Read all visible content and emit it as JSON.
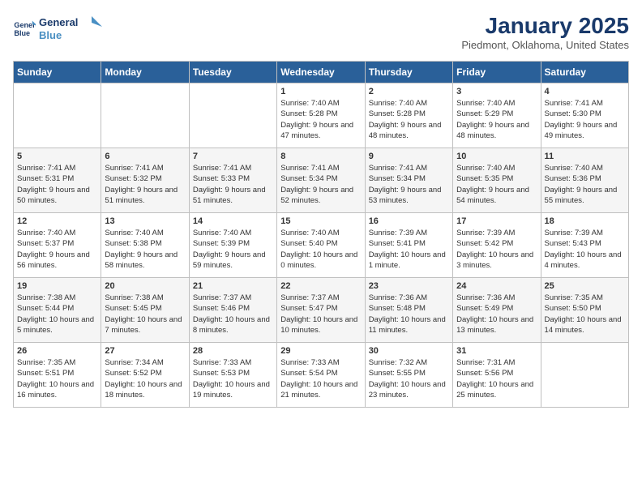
{
  "header": {
    "logo_line1": "General",
    "logo_line2": "Blue",
    "month": "January 2025",
    "location": "Piedmont, Oklahoma, United States"
  },
  "days_of_week": [
    "Sunday",
    "Monday",
    "Tuesday",
    "Wednesday",
    "Thursday",
    "Friday",
    "Saturday"
  ],
  "weeks": [
    [
      {
        "day": "",
        "info": ""
      },
      {
        "day": "",
        "info": ""
      },
      {
        "day": "",
        "info": ""
      },
      {
        "day": "1",
        "info": "Sunrise: 7:40 AM\nSunset: 5:28 PM\nDaylight: 9 hours and 47 minutes."
      },
      {
        "day": "2",
        "info": "Sunrise: 7:40 AM\nSunset: 5:28 PM\nDaylight: 9 hours and 48 minutes."
      },
      {
        "day": "3",
        "info": "Sunrise: 7:40 AM\nSunset: 5:29 PM\nDaylight: 9 hours and 48 minutes."
      },
      {
        "day": "4",
        "info": "Sunrise: 7:41 AM\nSunset: 5:30 PM\nDaylight: 9 hours and 49 minutes."
      }
    ],
    [
      {
        "day": "5",
        "info": "Sunrise: 7:41 AM\nSunset: 5:31 PM\nDaylight: 9 hours and 50 minutes."
      },
      {
        "day": "6",
        "info": "Sunrise: 7:41 AM\nSunset: 5:32 PM\nDaylight: 9 hours and 51 minutes."
      },
      {
        "day": "7",
        "info": "Sunrise: 7:41 AM\nSunset: 5:33 PM\nDaylight: 9 hours and 51 minutes."
      },
      {
        "day": "8",
        "info": "Sunrise: 7:41 AM\nSunset: 5:34 PM\nDaylight: 9 hours and 52 minutes."
      },
      {
        "day": "9",
        "info": "Sunrise: 7:41 AM\nSunset: 5:34 PM\nDaylight: 9 hours and 53 minutes."
      },
      {
        "day": "10",
        "info": "Sunrise: 7:40 AM\nSunset: 5:35 PM\nDaylight: 9 hours and 54 minutes."
      },
      {
        "day": "11",
        "info": "Sunrise: 7:40 AM\nSunset: 5:36 PM\nDaylight: 9 hours and 55 minutes."
      }
    ],
    [
      {
        "day": "12",
        "info": "Sunrise: 7:40 AM\nSunset: 5:37 PM\nDaylight: 9 hours and 56 minutes."
      },
      {
        "day": "13",
        "info": "Sunrise: 7:40 AM\nSunset: 5:38 PM\nDaylight: 9 hours and 58 minutes."
      },
      {
        "day": "14",
        "info": "Sunrise: 7:40 AM\nSunset: 5:39 PM\nDaylight: 9 hours and 59 minutes."
      },
      {
        "day": "15",
        "info": "Sunrise: 7:40 AM\nSunset: 5:40 PM\nDaylight: 10 hours and 0 minutes."
      },
      {
        "day": "16",
        "info": "Sunrise: 7:39 AM\nSunset: 5:41 PM\nDaylight: 10 hours and 1 minute."
      },
      {
        "day": "17",
        "info": "Sunrise: 7:39 AM\nSunset: 5:42 PM\nDaylight: 10 hours and 3 minutes."
      },
      {
        "day": "18",
        "info": "Sunrise: 7:39 AM\nSunset: 5:43 PM\nDaylight: 10 hours and 4 minutes."
      }
    ],
    [
      {
        "day": "19",
        "info": "Sunrise: 7:38 AM\nSunset: 5:44 PM\nDaylight: 10 hours and 5 minutes."
      },
      {
        "day": "20",
        "info": "Sunrise: 7:38 AM\nSunset: 5:45 PM\nDaylight: 10 hours and 7 minutes."
      },
      {
        "day": "21",
        "info": "Sunrise: 7:37 AM\nSunset: 5:46 PM\nDaylight: 10 hours and 8 minutes."
      },
      {
        "day": "22",
        "info": "Sunrise: 7:37 AM\nSunset: 5:47 PM\nDaylight: 10 hours and 10 minutes."
      },
      {
        "day": "23",
        "info": "Sunrise: 7:36 AM\nSunset: 5:48 PM\nDaylight: 10 hours and 11 minutes."
      },
      {
        "day": "24",
        "info": "Sunrise: 7:36 AM\nSunset: 5:49 PM\nDaylight: 10 hours and 13 minutes."
      },
      {
        "day": "25",
        "info": "Sunrise: 7:35 AM\nSunset: 5:50 PM\nDaylight: 10 hours and 14 minutes."
      }
    ],
    [
      {
        "day": "26",
        "info": "Sunrise: 7:35 AM\nSunset: 5:51 PM\nDaylight: 10 hours and 16 minutes."
      },
      {
        "day": "27",
        "info": "Sunrise: 7:34 AM\nSunset: 5:52 PM\nDaylight: 10 hours and 18 minutes."
      },
      {
        "day": "28",
        "info": "Sunrise: 7:33 AM\nSunset: 5:53 PM\nDaylight: 10 hours and 19 minutes."
      },
      {
        "day": "29",
        "info": "Sunrise: 7:33 AM\nSunset: 5:54 PM\nDaylight: 10 hours and 21 minutes."
      },
      {
        "day": "30",
        "info": "Sunrise: 7:32 AM\nSunset: 5:55 PM\nDaylight: 10 hours and 23 minutes."
      },
      {
        "day": "31",
        "info": "Sunrise: 7:31 AM\nSunset: 5:56 PM\nDaylight: 10 hours and 25 minutes."
      },
      {
        "day": "",
        "info": ""
      }
    ]
  ]
}
